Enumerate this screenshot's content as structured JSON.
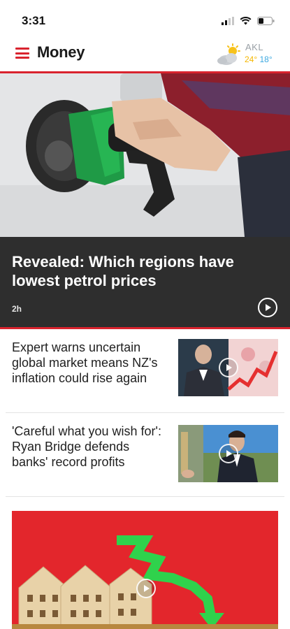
{
  "status_bar": {
    "time": "3:31"
  },
  "header": {
    "section_title": "Money",
    "weather": {
      "city": "AKL",
      "high": "24°",
      "low": "18°",
      "icon": "partly-cloudy-icon"
    },
    "accent_color": "#d9232e"
  },
  "hero": {
    "headline": "Revealed: Which regions have lowest petrol prices",
    "time_ago": "2h",
    "has_video": true
  },
  "articles": [
    {
      "title": "Expert warns uncertain global market means NZ's inflation could rise again",
      "has_video": true
    },
    {
      "title": "'Careful what you wish for': Ryan Bridge defends banks' record profits",
      "has_video": true
    }
  ],
  "bottom_card": {
    "has_video": true
  }
}
